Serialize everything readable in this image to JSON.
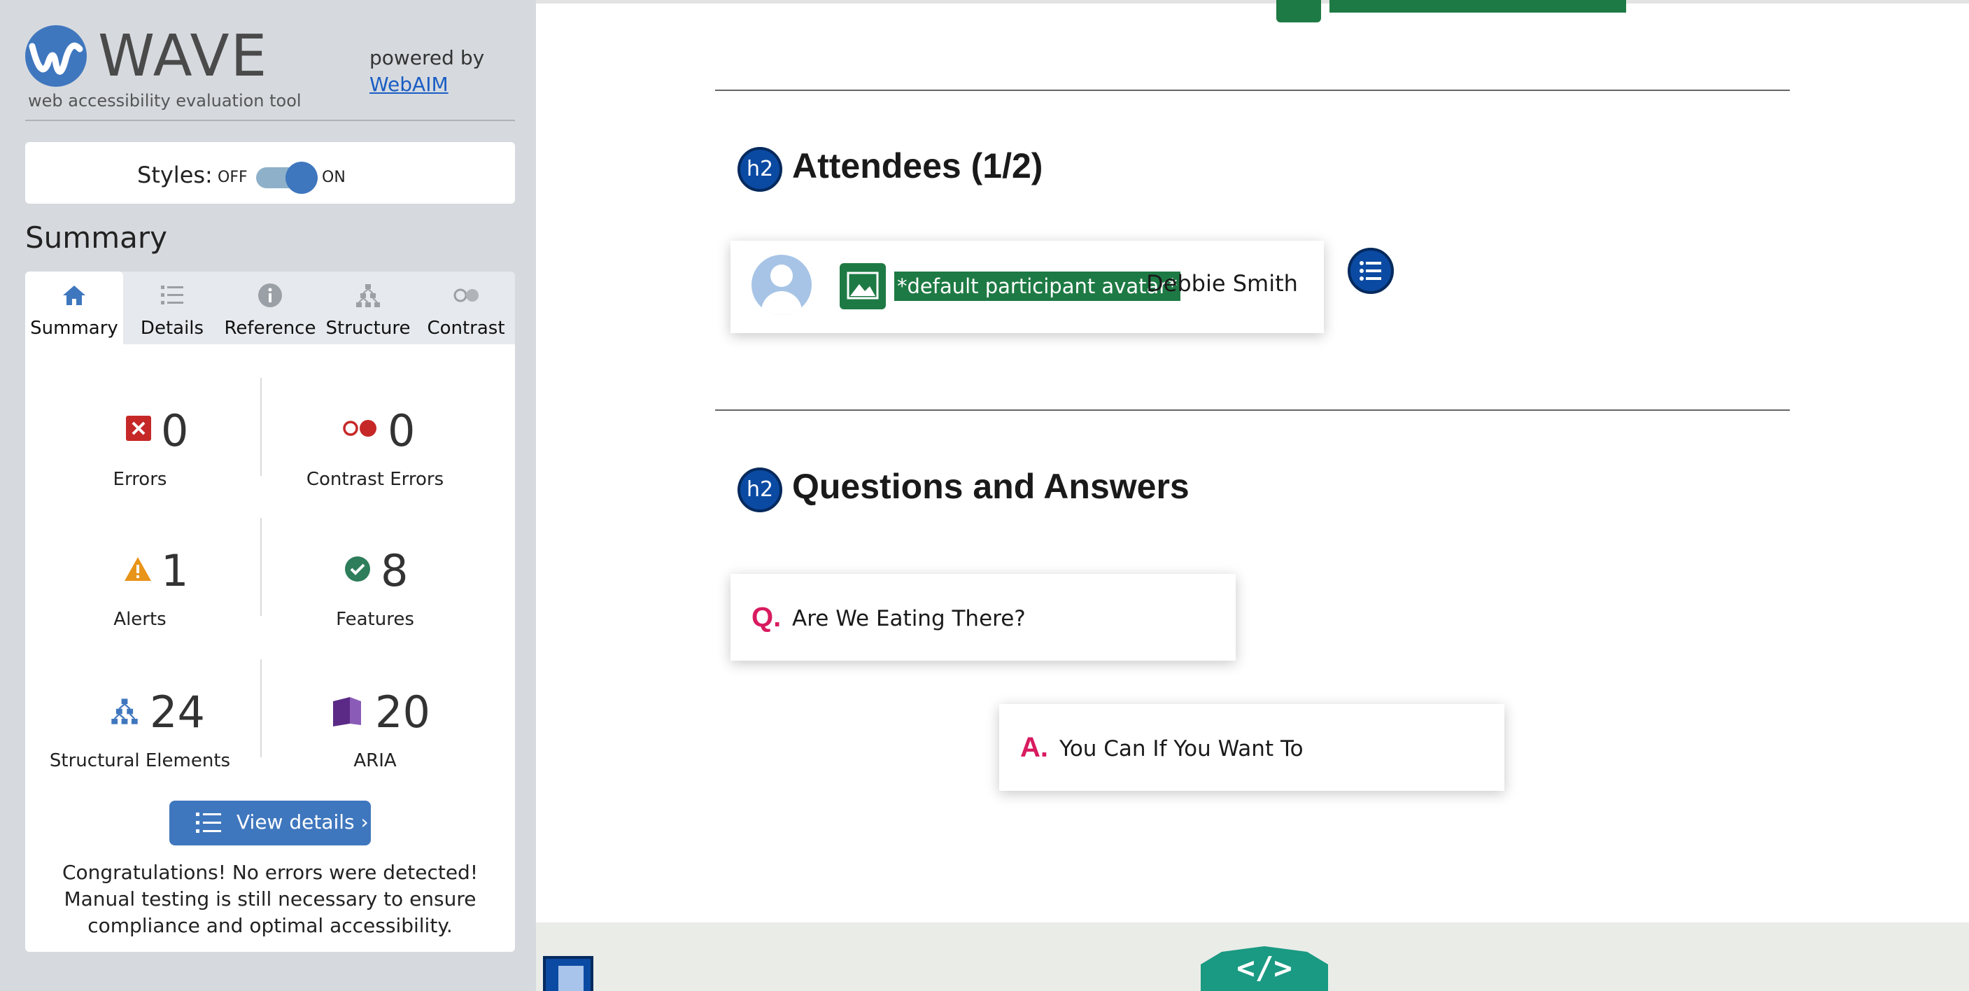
{
  "wave": {
    "logo_text": "WAVE",
    "subtitle": "web accessibility evaluation tool",
    "powered_by": "powered by",
    "powered_link": "WebAIM",
    "styles_label": "Styles:",
    "toggle_off": "OFF",
    "toggle_on": "ON",
    "summary_title": "Summary",
    "tabs": [
      {
        "label": "Summary",
        "icon": "home-icon",
        "active": true
      },
      {
        "label": "Details",
        "icon": "list-icon",
        "active": false
      },
      {
        "label": "Reference",
        "icon": "info-icon",
        "active": false
      },
      {
        "label": "Structure",
        "icon": "structure-icon",
        "active": false
      },
      {
        "label": "Contrast",
        "icon": "contrast-icon",
        "active": false
      }
    ],
    "stats": {
      "errors": {
        "value": "0",
        "label": "Errors",
        "color": "#c62828"
      },
      "contrast_errors": {
        "value": "0",
        "label": "Contrast Errors",
        "color": "#c62828"
      },
      "alerts": {
        "value": "1",
        "label": "Alerts",
        "color": "#e8941a"
      },
      "features": {
        "value": "8",
        "label": "Features",
        "color": "#2e7d5b"
      },
      "structural": {
        "value": "24",
        "label": "Structural Elements",
        "color": "#3f77be"
      },
      "aria": {
        "value": "20",
        "label": "ARIA",
        "color": "#5b2a86"
      }
    },
    "view_details": "View details ›",
    "congrats": "Congratulations! No errors were detected! Manual testing is still necessary to ensure compliance and optimal accessibility."
  },
  "content": {
    "h2_badge": "h2",
    "attendees_heading": "Attendees (1/2)",
    "attendee": {
      "alt_label": "*default participant avatar*",
      "name": "Debbie Smith"
    },
    "qa_heading": "Questions and Answers",
    "question": {
      "letter": "Q.",
      "text": "Are We Eating There?"
    },
    "answer": {
      "letter": "A.",
      "text": "You Can If You Want To"
    },
    "code_badge": "</>"
  },
  "colors": {
    "wave_blue": "#3f77be",
    "h2_badge": "#0b4aa2",
    "alt_green": "#1e7a44",
    "qa_pink": "#d81b60",
    "code_teal": "#1a9a82"
  }
}
